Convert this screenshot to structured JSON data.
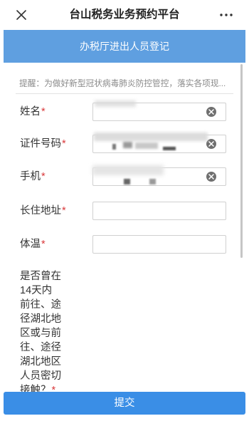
{
  "nav": {
    "close_icon": "close-icon",
    "title": "台山税务业务预约平台",
    "more_icon": "more-icon"
  },
  "header": {
    "title": "办税厅进出人员登记"
  },
  "notice": {
    "text": "提醒：为做好新型冠状病毒肺炎防控管控，落实各项现..."
  },
  "form": {
    "required_mark": "*",
    "fields": [
      {
        "label": "姓名",
        "clear_icon": "clear-icon"
      },
      {
        "label": "证件号码",
        "clear_icon": "clear-icon"
      },
      {
        "label": "手机",
        "clear_icon": "clear-icon"
      },
      {
        "label": "长住地址"
      },
      {
        "label": "体温"
      }
    ],
    "question": {
      "label": "是否曾在14天内前往、途径湖北地区或与前往、途径湖北地区人员密切接触？"
    }
  },
  "submit": {
    "label": "提交"
  },
  "colors": {
    "header": "#5f9fe0",
    "button": "#3a8ee6",
    "required": "#d9383a",
    "text": "#333333",
    "muted": "#8a8a8a"
  }
}
